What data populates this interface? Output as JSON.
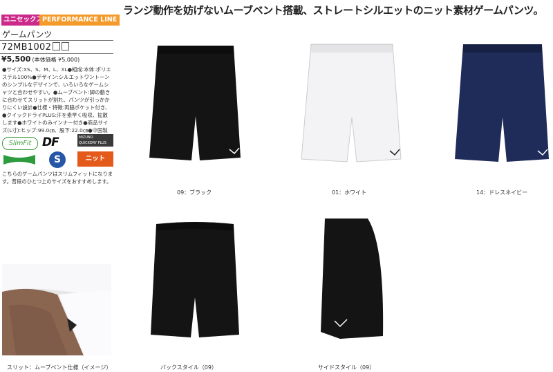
{
  "headline": "ランジ動作を妨げないムーブベント搭載、ストレートシルエットのニット素材ゲームパンツ。",
  "tags": {
    "uni": "ユニセックス",
    "line": "PERFORMANCE LINE"
  },
  "product": {
    "name": "ゲームパンツ",
    "code": "72MB1002",
    "price": "¥5,500",
    "price_note": "(本体価格 ¥5,000)",
    "description": "●サイズ:XS、S、M、L、XL●組成:本体:ポリエステル100%●デザイン:シルエットワントーンのシンプルなデザインで、いろいろなゲームシャツと合わせやすい。●ムーブベント:脚の動きに合わせてスリットが割れ、パンツが引っかかりにくい設計●仕様・特徴:両脇ポケット付き、●クイックドライPLUS:汗を素早く吸収、拡散します●ホワイトのみインナー付き●商品サイズ(L寸):ヒップ:99.0㎝、股下:22.0㎝●中国製",
    "note": "こちらのゲームパンツはスリムフィットになります。普段のひとつ上のサイズをおすすめします。"
  },
  "badges": {
    "slimfit": "SlimFit",
    "df": "DF",
    "mizuno": "MIZUNO QUICKDRY PLUS",
    "s": "S",
    "knit": "ニット"
  },
  "variants": [
    {
      "caption": "09：ブラック",
      "color": "#141414"
    },
    {
      "caption": "01：ホワイト",
      "color": "#f3f3f6"
    },
    {
      "caption": "14：ドレスネイビー",
      "color": "#1f2c5a"
    }
  ],
  "views": [
    {
      "caption": "バックスタイル（09）"
    },
    {
      "caption": "サイドスタイル（09）"
    }
  ],
  "detail_caption": "スリット：ムーブベント仕様（イメージ）"
}
